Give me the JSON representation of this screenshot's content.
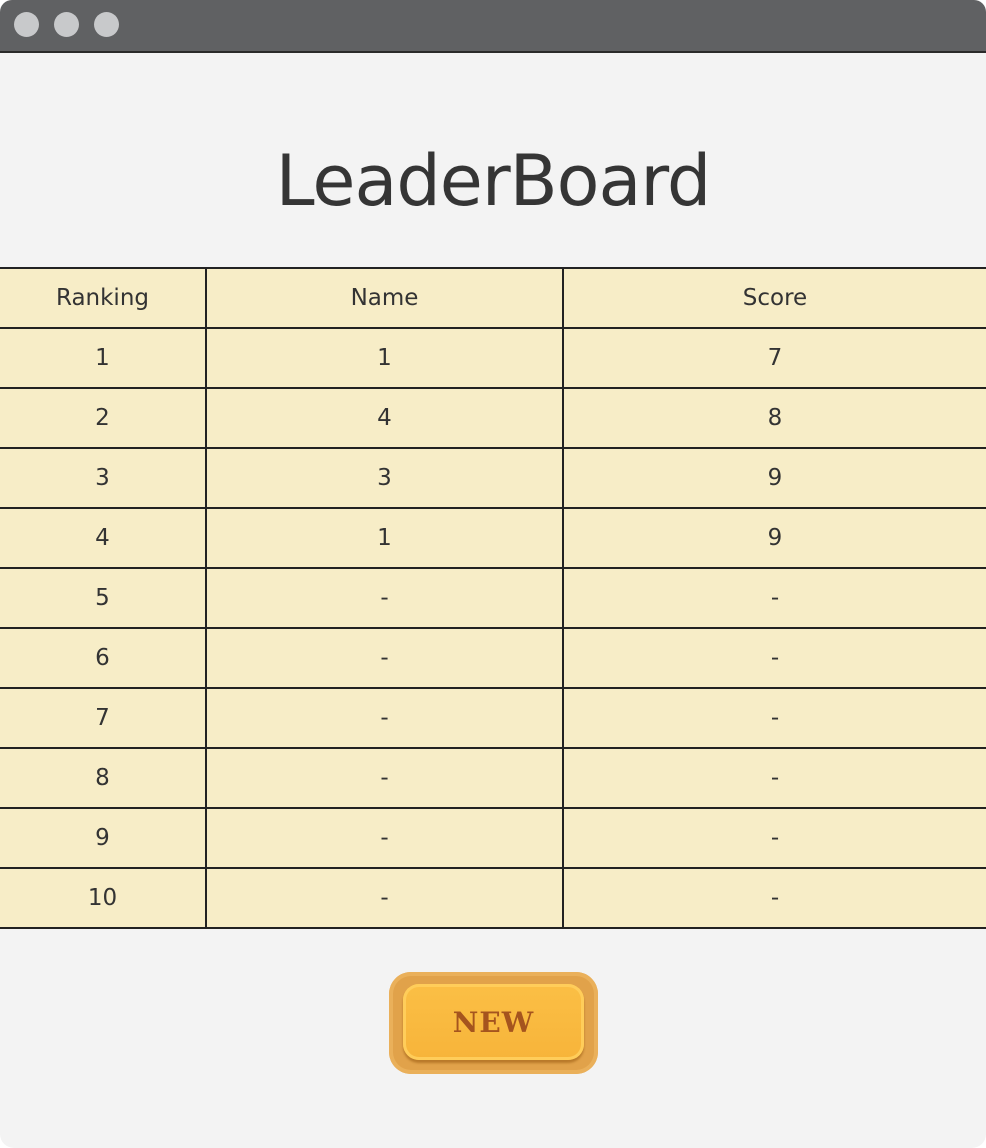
{
  "window": {
    "controls": [
      "close",
      "minimize",
      "maximize"
    ]
  },
  "title": "LeaderBoard",
  "table": {
    "headers": [
      "Ranking",
      "Name",
      "Score"
    ],
    "rows": [
      [
        "1",
        "1",
        "7"
      ],
      [
        "2",
        "4",
        "8"
      ],
      [
        "3",
        "3",
        "9"
      ],
      [
        "4",
        "1",
        "9"
      ],
      [
        "5",
        "-",
        "-"
      ],
      [
        "6",
        "-",
        "-"
      ],
      [
        "7",
        "-",
        "-"
      ],
      [
        "8",
        "-",
        "-"
      ],
      [
        "9",
        "-",
        "-"
      ],
      [
        "10",
        "-",
        "-"
      ]
    ]
  },
  "new_button": "NEW"
}
